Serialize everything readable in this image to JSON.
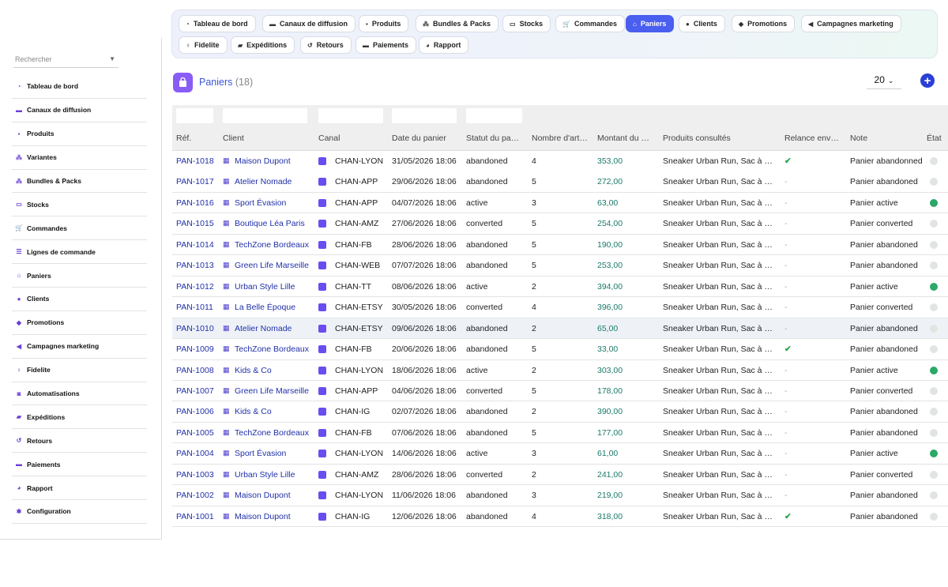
{
  "topnav": [
    {
      "label": "Tableau de bord",
      "icon": "dashboard-icon",
      "glyph": "◔"
    },
    {
      "label": "Canaux de diffusion",
      "icon": "channels-icon",
      "glyph": "▬"
    },
    {
      "label": "Produits",
      "icon": "products-icon",
      "glyph": "▪"
    },
    {
      "label": "Bundles & Packs",
      "icon": "bundles-icon",
      "glyph": "⁂"
    },
    {
      "label": "Stocks",
      "icon": "stocks-icon",
      "glyph": "▭"
    },
    {
      "label": "Commandes",
      "icon": "cart-icon",
      "glyph": "🛒"
    },
    {
      "label": "Paniers",
      "icon": "basket-icon",
      "glyph": "⌂"
    },
    {
      "label": "Clients",
      "icon": "user-icon",
      "glyph": "●"
    },
    {
      "label": "Promotions",
      "icon": "tag-icon",
      "glyph": "◆"
    },
    {
      "label": "Campagnes marketing",
      "icon": "megaphone-icon",
      "glyph": "◀"
    },
    {
      "label": "Fidelite",
      "icon": "award-icon",
      "glyph": "♀"
    },
    {
      "label": "Expéditions",
      "icon": "truck-icon",
      "glyph": "▰"
    },
    {
      "label": "Retours",
      "icon": "undo-icon",
      "glyph": "↺"
    },
    {
      "label": "Paiements",
      "icon": "payment-icon",
      "glyph": "▬"
    },
    {
      "label": "Rapport",
      "icon": "chart-pie-icon",
      "glyph": "◕"
    }
  ],
  "sidebar": {
    "search_placeholder": "Rechercher",
    "items": [
      {
        "label": "Tableau de bord",
        "icon": "dashboard-icon",
        "glyph": "◔"
      },
      {
        "label": "Canaux de diffusion",
        "icon": "channels-icon",
        "glyph": "▬"
      },
      {
        "label": "Produits",
        "icon": "products-icon",
        "glyph": "▪"
      },
      {
        "label": "Variantes",
        "icon": "variants-icon",
        "glyph": "⁂"
      },
      {
        "label": "Bundles & Packs",
        "icon": "bundles-icon",
        "glyph": "⁂"
      },
      {
        "label": "Stocks",
        "icon": "stocks-icon",
        "glyph": "▭"
      },
      {
        "label": "Commandes",
        "icon": "cart-icon",
        "glyph": "🛒"
      },
      {
        "label": "Lignes de commande",
        "icon": "list-icon",
        "glyph": "☰"
      },
      {
        "label": "Paniers",
        "icon": "basket-icon",
        "glyph": "⌂"
      },
      {
        "label": "Clients",
        "icon": "user-icon",
        "glyph": "●"
      },
      {
        "label": "Promotions",
        "icon": "tag-icon",
        "glyph": "◆"
      },
      {
        "label": "Campagnes marketing",
        "icon": "megaphone-icon",
        "glyph": "◀"
      },
      {
        "label": "Fidelite",
        "icon": "award-icon",
        "glyph": "♀"
      },
      {
        "label": "Automatisations",
        "icon": "robot-icon",
        "glyph": "◙"
      },
      {
        "label": "Expéditions",
        "icon": "truck-icon",
        "glyph": "▰"
      },
      {
        "label": "Retours",
        "icon": "undo-icon",
        "glyph": "↺"
      },
      {
        "label": "Paiements",
        "icon": "payment-icon",
        "glyph": "▬"
      },
      {
        "label": "Rapport",
        "icon": "chart-pie-icon",
        "glyph": "◕"
      },
      {
        "label": "Configuration",
        "icon": "gear-icon",
        "glyph": "✱"
      }
    ]
  },
  "header": {
    "title": "Paniers",
    "count": "(18)",
    "per_page": "20",
    "add_label": "+"
  },
  "colors": {
    "accent": "#4a5ef0",
    "link": "#2030a8",
    "amount": "#1a7a6a",
    "active_dot": "#2ca86a",
    "inactive_dot": "#e1e5e2"
  },
  "table": {
    "columns": [
      "Réf.",
      "Client",
      "Canal",
      "Date du panier",
      "Statut du panier",
      "Nombre d'articles",
      "Montant du panier",
      "Produits consultés",
      "Relance envoyée",
      "Note",
      "État"
    ],
    "rows": [
      {
        "ref": "PAN-1018",
        "client": "Maison Dupont",
        "canal": "CHAN-LYON",
        "date": "31/05/2026 18:06",
        "statut": "abandoned",
        "nb": "4",
        "montant": "353,00",
        "produits": "Sneaker Urban Run, Sac à dos",
        "relance": true,
        "note": "Panier abandonned",
        "etat": false
      },
      {
        "ref": "PAN-1017",
        "client": "Atelier Nomade",
        "canal": "CHAN-APP",
        "date": "29/06/2026 18:06",
        "statut": "abandoned",
        "nb": "5",
        "montant": "272,00",
        "produits": "Sneaker Urban Run, Sac à dos",
        "relance": false,
        "note": "Panier abandoned",
        "etat": false
      },
      {
        "ref": "PAN-1016",
        "client": "Sport Évasion",
        "canal": "CHAN-APP",
        "date": "04/07/2026 18:06",
        "statut": "active",
        "nb": "3",
        "montant": "63,00",
        "produits": "Sneaker Urban Run, Sac à dos",
        "relance": false,
        "note": "Panier active",
        "etat": true
      },
      {
        "ref": "PAN-1015",
        "client": "Boutique Léa Paris",
        "canal": "CHAN-AMZ",
        "date": "27/06/2026 18:06",
        "statut": "converted",
        "nb": "5",
        "montant": "254,00",
        "produits": "Sneaker Urban Run, Sac à dos",
        "relance": false,
        "note": "Panier converted",
        "etat": false
      },
      {
        "ref": "PAN-1014",
        "client": "TechZone Bordeaux",
        "canal": "CHAN-FB",
        "date": "28/06/2026 18:06",
        "statut": "abandoned",
        "nb": "5",
        "montant": "190,00",
        "produits": "Sneaker Urban Run, Sac à dos",
        "relance": false,
        "note": "Panier abandoned",
        "etat": false
      },
      {
        "ref": "PAN-1013",
        "client": "Green Life Marseille",
        "canal": "CHAN-WEB",
        "date": "07/07/2026 18:06",
        "statut": "abandoned",
        "nb": "5",
        "montant": "253,00",
        "produits": "Sneaker Urban Run, Sac à dos",
        "relance": false,
        "note": "Panier abandoned",
        "etat": false
      },
      {
        "ref": "PAN-1012",
        "client": "Urban Style Lille",
        "canal": "CHAN-TT",
        "date": "08/06/2026 18:06",
        "statut": "active",
        "nb": "2",
        "montant": "394,00",
        "produits": "Sneaker Urban Run, Sac à dos",
        "relance": false,
        "note": "Panier active",
        "etat": true
      },
      {
        "ref": "PAN-1011",
        "client": "La Belle Époque",
        "canal": "CHAN-ETSY",
        "date": "30/05/2026 18:06",
        "statut": "converted",
        "nb": "4",
        "montant": "396,00",
        "produits": "Sneaker Urban Run, Sac à dos",
        "relance": false,
        "note": "Panier converted",
        "etat": false
      },
      {
        "ref": "PAN-1010",
        "client": "Atelier Nomade",
        "canal": "CHAN-ETSY",
        "date": "09/06/2026 18:06",
        "statut": "abandoned",
        "nb": "2",
        "montant": "65,00",
        "produits": "Sneaker Urban Run, Sac à dos",
        "relance": false,
        "note": "Panier abandoned",
        "etat": false
      },
      {
        "ref": "PAN-1009",
        "client": "TechZone Bordeaux",
        "canal": "CHAN-FB",
        "date": "20/06/2026 18:06",
        "statut": "abandoned",
        "nb": "5",
        "montant": "33,00",
        "produits": "Sneaker Urban Run, Sac à dos",
        "relance": true,
        "note": "Panier abandoned",
        "etat": false
      },
      {
        "ref": "PAN-1008",
        "client": "Kids & Co",
        "canal": "CHAN-LYON",
        "date": "18/06/2026 18:06",
        "statut": "active",
        "nb": "2",
        "montant": "303,00",
        "produits": "Sneaker Urban Run, Sac à dos",
        "relance": false,
        "note": "Panier active",
        "etat": true
      },
      {
        "ref": "PAN-1007",
        "client": "Green Life Marseille",
        "canal": "CHAN-APP",
        "date": "04/06/2026 18:06",
        "statut": "converted",
        "nb": "5",
        "montant": "178,00",
        "produits": "Sneaker Urban Run, Sac à dos",
        "relance": false,
        "note": "Panier converted",
        "etat": false
      },
      {
        "ref": "PAN-1006",
        "client": "Kids & Co",
        "canal": "CHAN-IG",
        "date": "02/07/2026 18:06",
        "statut": "abandoned",
        "nb": "2",
        "montant": "390,00",
        "produits": "Sneaker Urban Run, Sac à dos",
        "relance": false,
        "note": "Panier abandoned",
        "etat": false
      },
      {
        "ref": "PAN-1005",
        "client": "TechZone Bordeaux",
        "canal": "CHAN-FB",
        "date": "07/06/2026 18:06",
        "statut": "abandoned",
        "nb": "5",
        "montant": "177,00",
        "produits": "Sneaker Urban Run, Sac à dos",
        "relance": false,
        "note": "Panier abandoned",
        "etat": false
      },
      {
        "ref": "PAN-1004",
        "client": "Sport Évasion",
        "canal": "CHAN-LYON",
        "date": "14/06/2026 18:06",
        "statut": "active",
        "nb": "3",
        "montant": "61,00",
        "produits": "Sneaker Urban Run, Sac à dos",
        "relance": false,
        "note": "Panier active",
        "etat": true
      },
      {
        "ref": "PAN-1003",
        "client": "Urban Style Lille",
        "canal": "CHAN-AMZ",
        "date": "28/06/2026 18:06",
        "statut": "converted",
        "nb": "2",
        "montant": "241,00",
        "produits": "Sneaker Urban Run, Sac à dos",
        "relance": false,
        "note": "Panier converted",
        "etat": false
      },
      {
        "ref": "PAN-1002",
        "client": "Maison Dupont",
        "canal": "CHAN-LYON",
        "date": "11/06/2026 18:06",
        "statut": "abandoned",
        "nb": "3",
        "montant": "219,00",
        "produits": "Sneaker Urban Run, Sac à dos",
        "relance": false,
        "note": "Panier abandoned",
        "etat": false
      },
      {
        "ref": "PAN-1001",
        "client": "Maison Dupont",
        "canal": "CHAN-IG",
        "date": "12/06/2026 18:06",
        "statut": "abandoned",
        "nb": "4",
        "montant": "318,00",
        "produits": "Sneaker Urban Run, Sac à dos",
        "relance": true,
        "note": "Panier abandoned",
        "etat": false
      }
    ]
  }
}
